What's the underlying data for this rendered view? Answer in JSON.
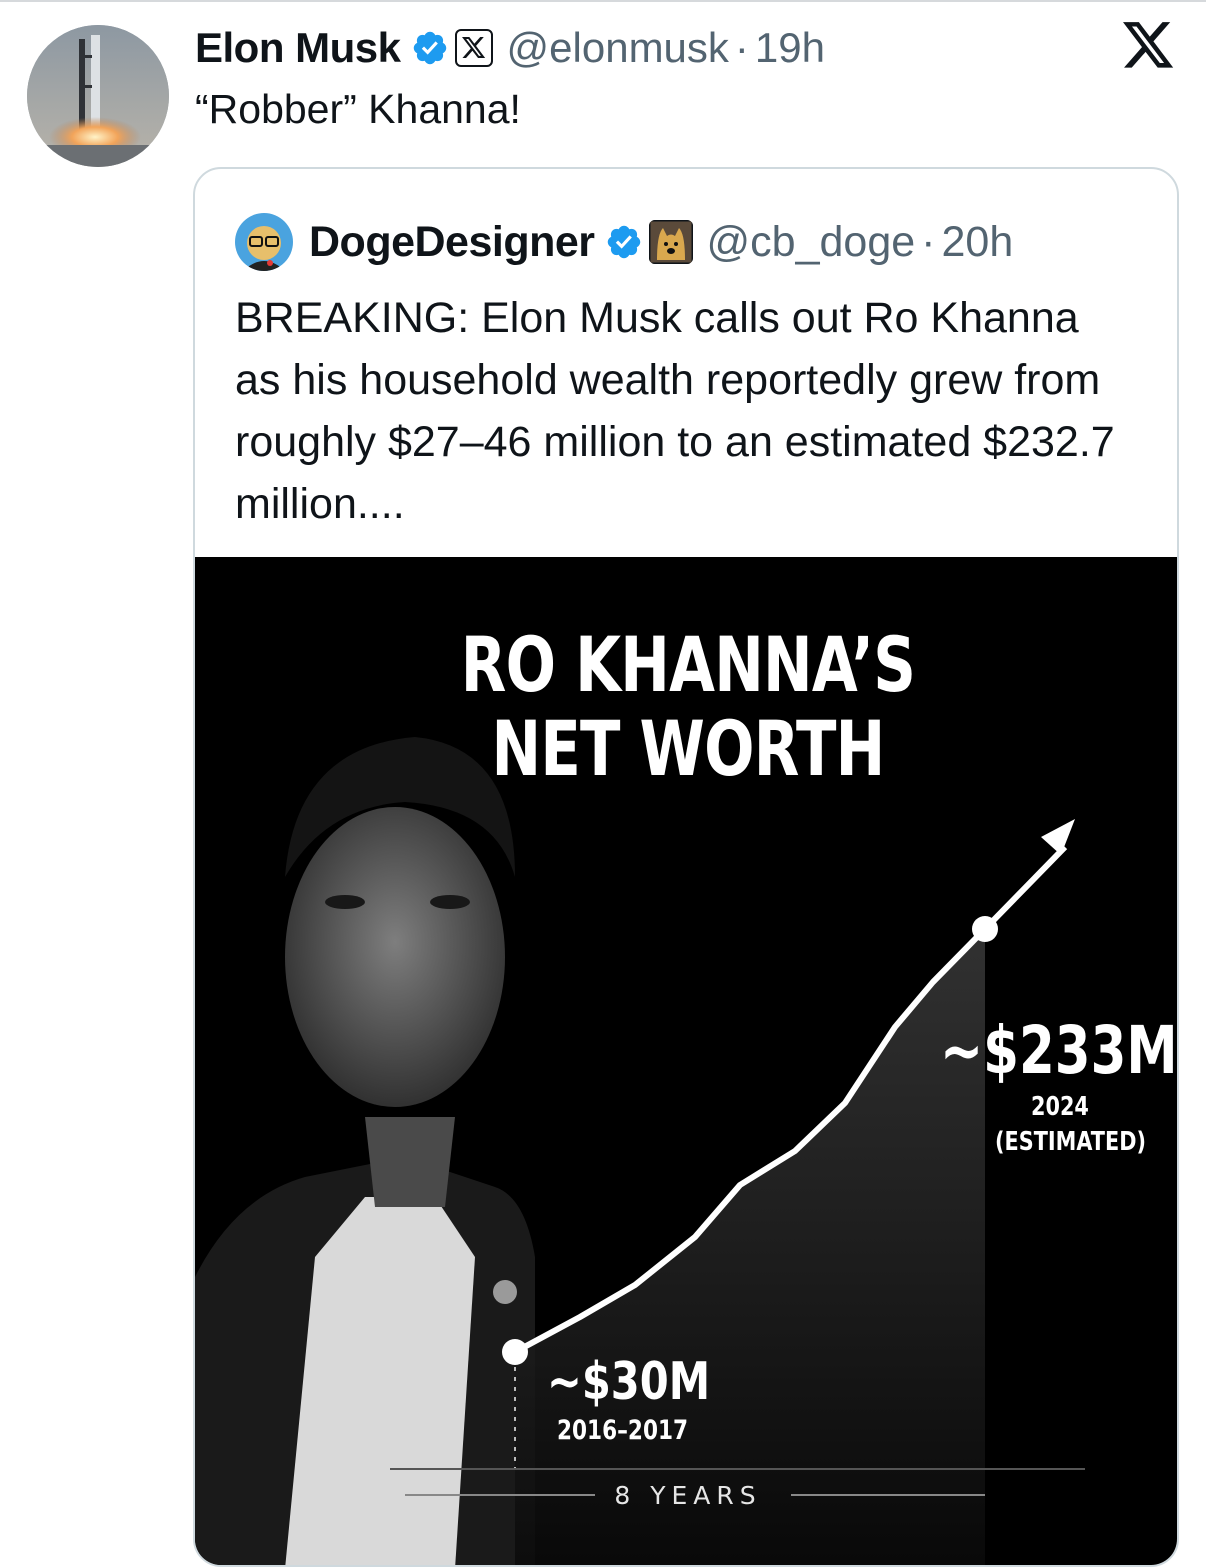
{
  "tweet": {
    "author_name": "Elon Musk",
    "handle": "@elonmusk",
    "separator": "·",
    "time": "19h",
    "text": "“Robber” Khanna!",
    "colors": {
      "verified": "#1d9bf0",
      "secondary_text": "#536471",
      "primary_text": "#0f1419"
    },
    "icons": [
      "rocket-avatar",
      "verified-badge-icon",
      "x-affiliate-badge-icon",
      "x-logo-icon"
    ]
  },
  "quote": {
    "author_name": "DogeDesigner",
    "handle": "@cb_doge",
    "separator": "·",
    "time": "20h",
    "text": "BREAKING: Elon Musk calls out Ro Khanna as his household wealth reportedly grew from roughly $27–46 million to an estimated $232.7 million....",
    "icons": [
      "doge-avatar",
      "verified-badge-icon",
      "doge-badge-icon"
    ]
  },
  "media": {
    "title_line1": "RO KHANNA’S",
    "title_line2": "NET WORTH",
    "start_value": "~$30M",
    "start_period": "2016–2017",
    "end_value": "~$233M",
    "end_year": "2024",
    "end_note": "(ESTIMATED)",
    "duration": "8 YEARS",
    "colors": {
      "background": "#000000",
      "line": "#ffffff"
    }
  }
}
